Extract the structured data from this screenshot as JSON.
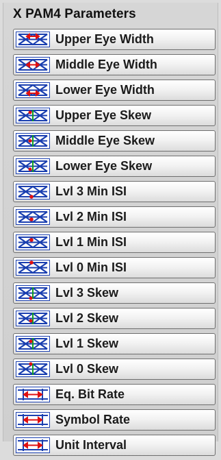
{
  "panel": {
    "title": "X PAM4 Parameters",
    "items": [
      {
        "label": "Upper Eye Width",
        "icon": "eye-width-icon"
      },
      {
        "label": "Middle Eye Width",
        "icon": "eye-width-icon"
      },
      {
        "label": "Lower Eye Width",
        "icon": "eye-width-icon"
      },
      {
        "label": "Upper Eye Skew",
        "icon": "eye-skew-icon"
      },
      {
        "label": "Middle Eye Skew",
        "icon": "eye-skew-icon"
      },
      {
        "label": "Lower Eye Skew",
        "icon": "eye-skew-icon"
      },
      {
        "label": "Lvl 3 Min ISI",
        "icon": "level-min-isi-icon"
      },
      {
        "label": "Lvl 2 Min ISI",
        "icon": "level-min-isi-icon"
      },
      {
        "label": "Lvl 1 Min ISI",
        "icon": "level-min-isi-icon"
      },
      {
        "label": "Lvl 0 Min ISI",
        "icon": "level-min-isi-icon"
      },
      {
        "label": "Lvl 3 Skew",
        "icon": "level-skew-icon"
      },
      {
        "label": "Lvl 2 Skew",
        "icon": "level-skew-icon"
      },
      {
        "label": "Lvl 1 Skew",
        "icon": "level-skew-icon"
      },
      {
        "label": "Lvl 0 Skew",
        "icon": "level-skew-icon"
      },
      {
        "label": "Eq. Bit Rate",
        "icon": "bit-rate-icon"
      },
      {
        "label": "Symbol Rate",
        "icon": "symbol-rate-icon"
      },
      {
        "label": "Unit Interval",
        "icon": "unit-interval-icon"
      }
    ]
  },
  "colors": {
    "icon_blue": "#1a3fb0",
    "icon_red": "#e01010",
    "icon_green": "#10a020"
  }
}
